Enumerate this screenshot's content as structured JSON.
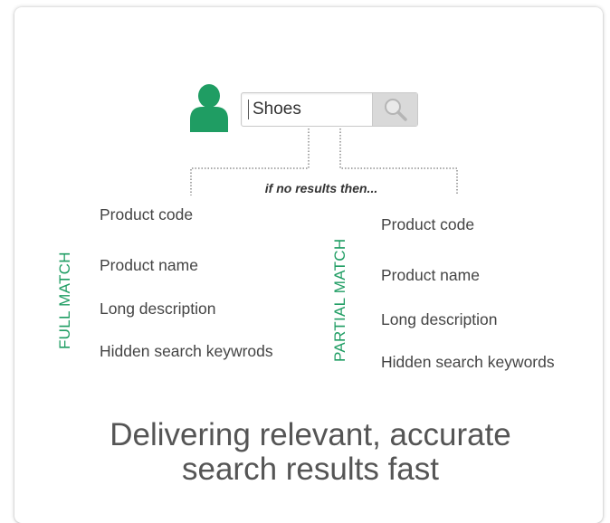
{
  "search": {
    "value": "Shoes",
    "button_icon": "magnifier-icon"
  },
  "user_icon": "person-icon",
  "connector_caption": "if no results then...",
  "full_match": {
    "label": "FULL MATCH",
    "items": [
      "Product code",
      "Product name",
      "Long description",
      "Hidden search keywrods"
    ]
  },
  "partial_match": {
    "label": "PARTIAL MATCH",
    "items": [
      "Product code",
      "Product name",
      "Long description",
      "Hidden search keywords"
    ]
  },
  "tagline": {
    "line1": "Delivering relevant, accurate",
    "line2": "search results fast"
  },
  "colors": {
    "accent_green": "#1f9d63",
    "text_gray": "#444444",
    "search_button_bg": "#d9d9d9"
  }
}
